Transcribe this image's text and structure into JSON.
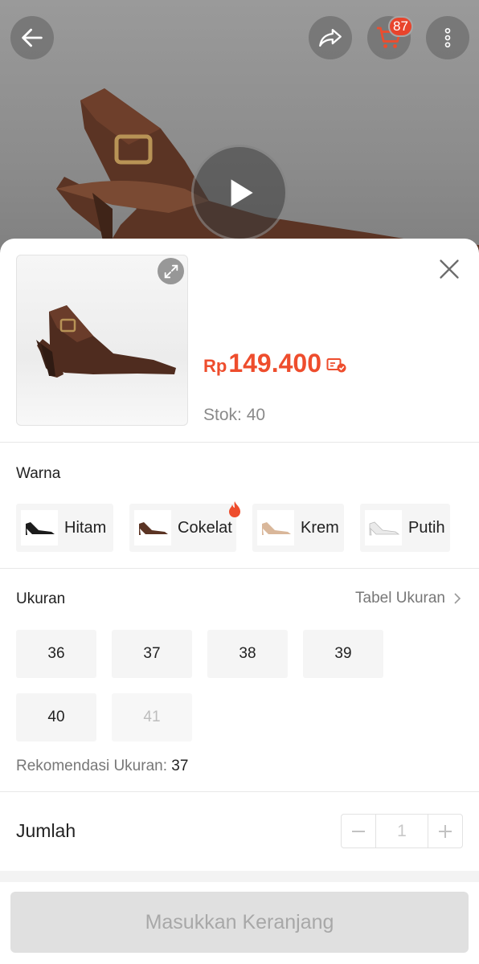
{
  "header": {
    "cart_count": "87",
    "icons": [
      "arrow-left-icon",
      "share-icon",
      "cart-icon",
      "more-vertical-icon",
      "play-icon"
    ]
  },
  "product": {
    "price_currency": "Rp",
    "price_amount": "149.400",
    "stock_label": "Stok: ",
    "stock_value": "40"
  },
  "colors": {
    "title": "Warna",
    "options": [
      {
        "label": "Hitam"
      },
      {
        "label": "Cokelat",
        "hot": true
      },
      {
        "label": "Krem"
      },
      {
        "label": "Putih"
      }
    ]
  },
  "sizes": {
    "title": "Ukuran",
    "chart_link": "Tabel Ukuran",
    "options": [
      {
        "label": "36",
        "available": true
      },
      {
        "label": "37",
        "available": true
      },
      {
        "label": "38",
        "available": true
      },
      {
        "label": "39",
        "available": true
      },
      {
        "label": "40",
        "available": true
      },
      {
        "label": "41",
        "available": false
      }
    ],
    "recommendation_label": "Rekomendasi Ukuran: ",
    "recommendation_value": "37"
  },
  "quantity": {
    "label": "Jumlah",
    "value": "1"
  },
  "cta": {
    "label": "Masukkan Keranjang"
  },
  "theme": {
    "accent": "#ee4d2d",
    "disabled_bg": "#e0e0e0"
  }
}
